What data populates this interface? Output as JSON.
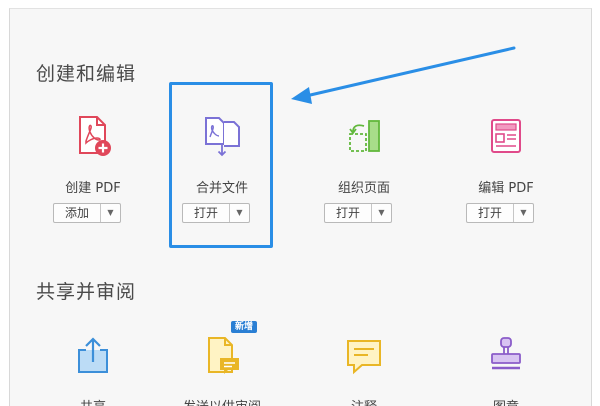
{
  "sections": {
    "create_edit": {
      "title": "创建和编辑"
    },
    "share_review": {
      "title": "共享并审阅"
    }
  },
  "tools": {
    "create_pdf": {
      "label": "创建 PDF",
      "button": "添加",
      "icon": "create-pdf-icon",
      "color": "#e0475a"
    },
    "combine_files": {
      "label": "合并文件",
      "button": "打开",
      "icon": "combine-files-icon",
      "color": "#7b72d6"
    },
    "organize_pages": {
      "label": "组织页面",
      "button": "打开",
      "icon": "organize-pages-icon",
      "color": "#62b83c"
    },
    "edit_pdf": {
      "label": "编辑 PDF",
      "button": "打开",
      "icon": "edit-pdf-icon",
      "color": "#e04a8a"
    },
    "share": {
      "label": "共享",
      "icon": "share-icon",
      "color": "#3c8fd9"
    },
    "send_review": {
      "label": "发送以供审阅",
      "badge": "新增",
      "icon": "send-review-icon",
      "color": "#e9b626"
    },
    "comment": {
      "label": "注释",
      "icon": "comment-icon",
      "color": "#e9b626"
    },
    "stamp": {
      "label": "图章",
      "icon": "stamp-icon",
      "color": "#8a5cc9"
    }
  },
  "dropdown_glyph": "▼",
  "accent_color": "#2a8ee6"
}
